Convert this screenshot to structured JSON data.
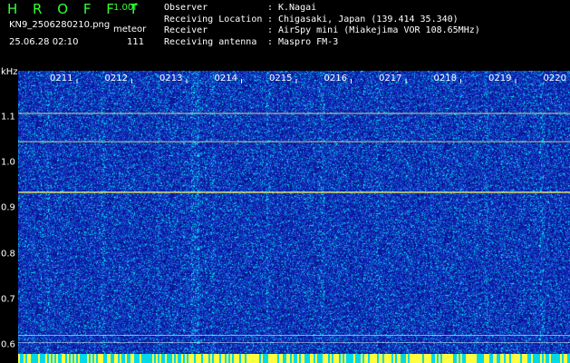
{
  "header": {
    "app_title": "H R O F F T",
    "version": "1.00f",
    "file_name": "KN9_2506280210.png",
    "mode": "meteor",
    "timestamp": "25.06.28 02:10",
    "count": "111"
  },
  "info": [
    {
      "label": "Observer",
      "sep": ":",
      "value": "K.Nagai"
    },
    {
      "label": "Receiving Location",
      "sep": ":",
      "value": "Chigasaki, Japan (139.414 35.340)"
    },
    {
      "label": "Receiver",
      "sep": ":",
      "value": "AirSpy mini (Miakejima VOR 108.65MHz)"
    },
    {
      "label": "Receiving antenna",
      "sep": ":",
      "value": "Maspro FM-3"
    }
  ],
  "axis": {
    "unit": "kHz",
    "y_ticks": [
      {
        "label": "1.1",
        "value": 1.1
      },
      {
        "label": "1.0",
        "value": 1.0
      },
      {
        "label": "0.9",
        "value": 0.9
      },
      {
        "label": "0.8",
        "value": 0.8
      },
      {
        "label": "0.7",
        "value": 0.7
      },
      {
        "label": "0.6",
        "value": 0.6
      }
    ],
    "time_labels": [
      "0211",
      "0212",
      "0213",
      "0214",
      "0215",
      "0216",
      "0217",
      "0218",
      "0219",
      "0220"
    ]
  },
  "colors": {
    "background": "#1020b0",
    "noise": "#00d8e8",
    "signal": "#ffff40",
    "header_accent": "#33ff33"
  }
}
